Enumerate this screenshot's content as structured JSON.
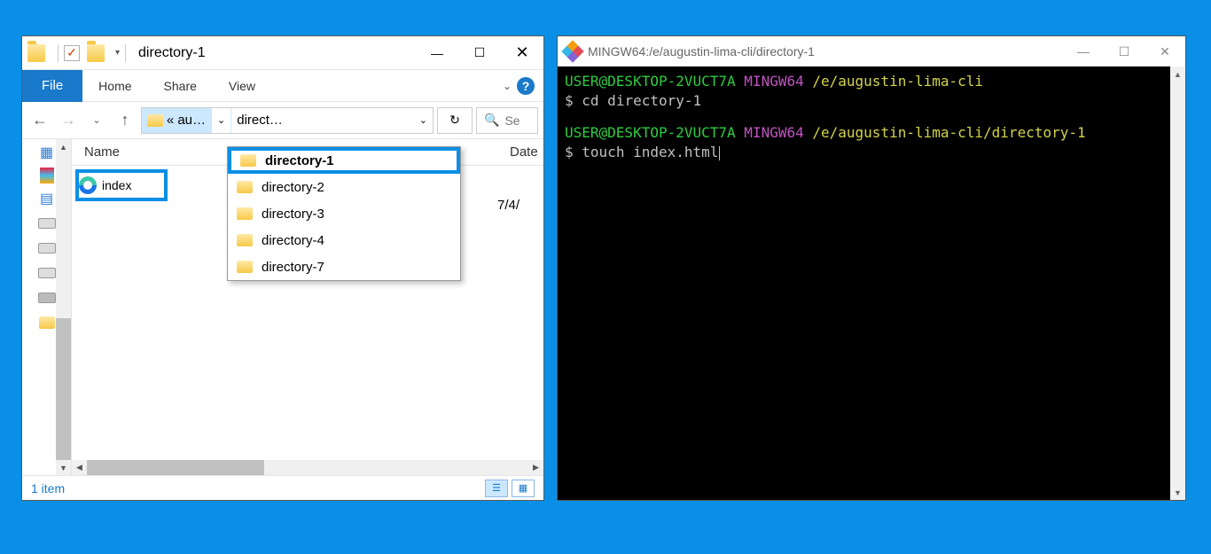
{
  "explorer": {
    "title": "directory-1",
    "ribbon": {
      "file": "File",
      "home": "Home",
      "share": "Share",
      "view": "View"
    },
    "address": {
      "ellipsis": "«",
      "parent": "au…",
      "current": "direct…"
    },
    "search_placeholder": "Se",
    "columns": {
      "name": "Name",
      "date": "Date"
    },
    "files": [
      {
        "name": "index",
        "date": "7/4/"
      }
    ],
    "dropdown": [
      {
        "label": "directory-1",
        "selected": true
      },
      {
        "label": "directory-2",
        "selected": false
      },
      {
        "label": "directory-3",
        "selected": false
      },
      {
        "label": "directory-4",
        "selected": false
      },
      {
        "label": "directory-7",
        "selected": false
      }
    ],
    "status": "1 item"
  },
  "terminal": {
    "title": "MINGW64:/e/augustin-lima-cli/directory-1",
    "lines": [
      {
        "user": "USER@DESKTOP-2VUCT7A",
        "sys": "MINGW64",
        "path": "/e/augustin-lima-cli",
        "cmd": "cd directory-1"
      },
      {
        "user": "USER@DESKTOP-2VUCT7A",
        "sys": "MINGW64",
        "path": "/e/augustin-lima-cli/directory-1",
        "cmd": "touch index.html"
      }
    ],
    "prompt_symbol": "$"
  }
}
